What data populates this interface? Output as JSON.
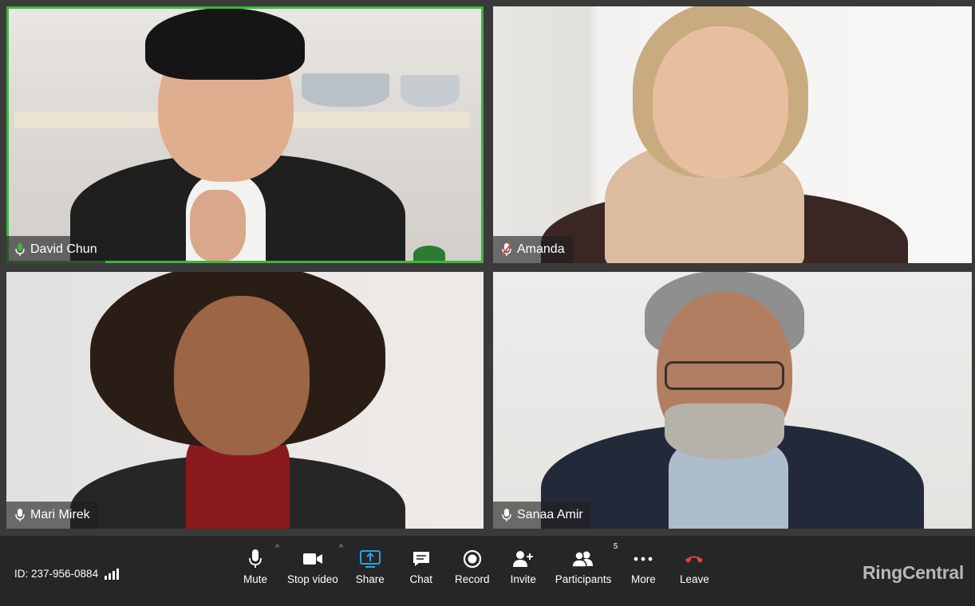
{
  "tiles": [
    {
      "name": "David Chun",
      "active": true,
      "mic": "active"
    },
    {
      "name": "Amanda",
      "active": false,
      "mic": "muted"
    },
    {
      "name": "Mari Mirek",
      "active": false,
      "mic": "normal"
    },
    {
      "name": "Sanaa Amir",
      "active": false,
      "mic": "normal"
    }
  ],
  "colors": {
    "active_speaker": "#3fb43c",
    "muted_mic": "#e0453f",
    "share_accent": "#2aa1e6",
    "leave": "#e0453f"
  },
  "toolbar": {
    "meeting_id": "ID: 237-956-0884",
    "mute_label": "Mute",
    "stop_video_label": "Stop video",
    "share_label": "Share",
    "chat_label": "Chat",
    "record_label": "Record",
    "invite_label": "Invite",
    "participants_label": "Participants",
    "participants_count": "5",
    "more_label": "More",
    "leave_label": "Leave"
  },
  "brand": {
    "logo_text": "RingCentral"
  }
}
